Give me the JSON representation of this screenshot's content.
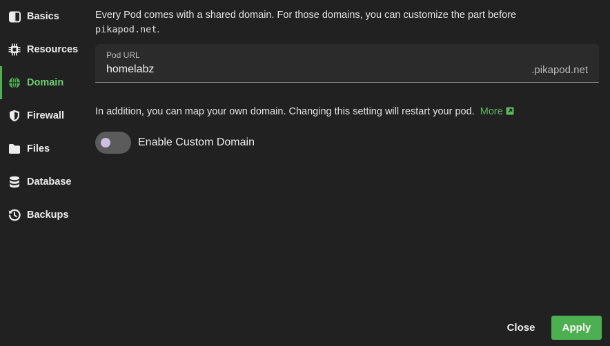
{
  "sidebar": {
    "items": [
      {
        "label": "Basics",
        "icon": "columns-icon"
      },
      {
        "label": "Resources",
        "icon": "chip-icon"
      },
      {
        "label": "Domain",
        "icon": "globe-icon",
        "active": true
      },
      {
        "label": "Firewall",
        "icon": "shield-icon"
      },
      {
        "label": "Files",
        "icon": "folder-icon"
      },
      {
        "label": "Database",
        "icon": "database-icon"
      },
      {
        "label": "Backups",
        "icon": "history-icon"
      }
    ]
  },
  "domain": {
    "intro_text": "Every Pod comes with a shared domain. For those domains, you can customize the part before",
    "intro_domain": "pikapod.net",
    "intro_end": ".",
    "pod_url_label": "Pod URL",
    "pod_url_value": "homelabz",
    "pod_url_suffix": ".pikapod.net",
    "custom_text": "In addition, you can map your own domain. Changing this setting will restart your pod.",
    "more_link": "More",
    "toggle_label": "Enable Custom Domain",
    "toggle_enabled": false
  },
  "footer": {
    "close_label": "Close",
    "apply_label": "Apply"
  },
  "colors": {
    "background": "#212121",
    "accent": "#4caf50",
    "active_text": "#6ccf6f"
  }
}
